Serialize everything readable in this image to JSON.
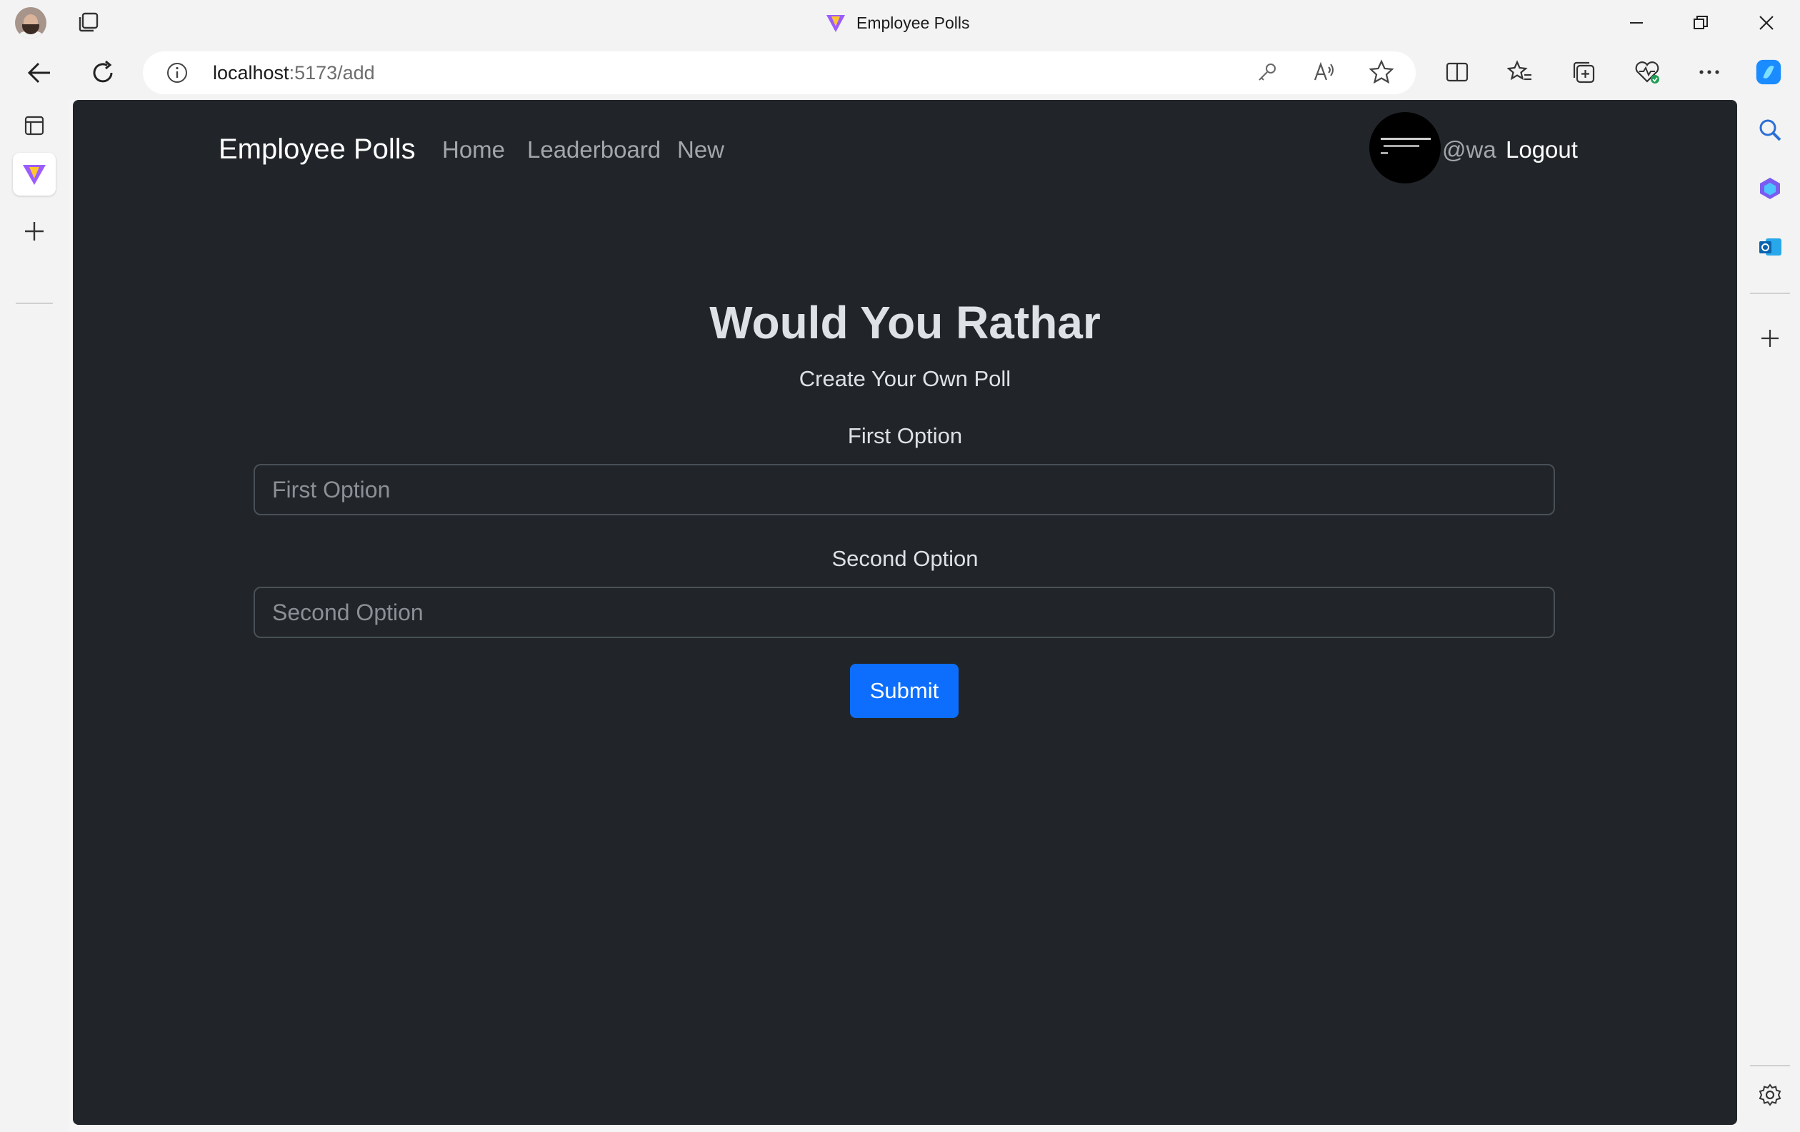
{
  "browser": {
    "window_title": "Employee Polls",
    "url_host": "localhost",
    "url_path": ":5173/add"
  },
  "navbar": {
    "brand": "Employee Polls",
    "links": [
      "Home",
      "Leaderboard",
      "New"
    ],
    "username": "@wa",
    "logout": "Logout"
  },
  "form": {
    "title": "Would You Rathar",
    "subtitle": "Create Your Own Poll",
    "first_label": "First Option",
    "first_placeholder": "First Option",
    "second_label": "Second Option",
    "second_placeholder": "Second Option",
    "submit": "Submit"
  },
  "colors": {
    "page_bg": "#212529",
    "primary": "#0d6efd",
    "text": "#dee2e6",
    "nav_muted": "#a3a7ab"
  }
}
